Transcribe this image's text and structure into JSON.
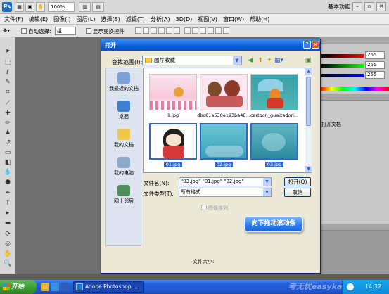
{
  "app": {
    "logo": "Ps",
    "zoom": "100%",
    "workspace": "基本功能"
  },
  "menu": [
    "文件(F)",
    "编辑(E)",
    "图像(I)",
    "图层(L)",
    "选择(S)",
    "滤镜(T)",
    "分析(A)",
    "3D(D)",
    "视图(V)",
    "窗口(W)",
    "帮助(H)"
  ],
  "options": {
    "auto_select_label": "自动选择:",
    "auto_select_value": "组",
    "show_transform_label": "显示变换控件"
  },
  "panels": {
    "values": [
      "255",
      "255",
      "255"
    ],
    "open_doc_text": "打开文档"
  },
  "dialog": {
    "title": "打开",
    "help": "?",
    "close": "✕",
    "look_in_label": "查找范围(I):",
    "look_in_value": "图片收藏",
    "places": [
      "我最近的文档",
      "桌面",
      "我的文档",
      "我的电脑",
      "网上邻居"
    ],
    "files": [
      {
        "name": "1.jpg",
        "selected": false
      },
      {
        "name": "dbc81a530e193ba48...",
        "selected": false
      },
      {
        "name": "cartoon_guaizadori...",
        "selected": false
      },
      {
        "name": "01.jpg",
        "selected": true
      },
      {
        "name": "02.jpg",
        "selected": true
      },
      {
        "name": "03.jpg",
        "selected": true
      }
    ],
    "filename_label": "文件名(N):",
    "filename_value": "\"03.jpg\" \"01.jpg\" \"02.jpg\"",
    "filetype_label": "文件类型(T):",
    "filetype_value": "所有格式",
    "open_button": "打开(O)",
    "cancel_button": "取消",
    "image_sequence_label": "图像序列",
    "callout": "向下拖动滚动条",
    "file_size_label": "文件大小:"
  },
  "taskbar": {
    "start": "开始",
    "task": "Adobe Photoshop ...",
    "watermark": "考无忧easykao",
    "clock": "14:32"
  }
}
